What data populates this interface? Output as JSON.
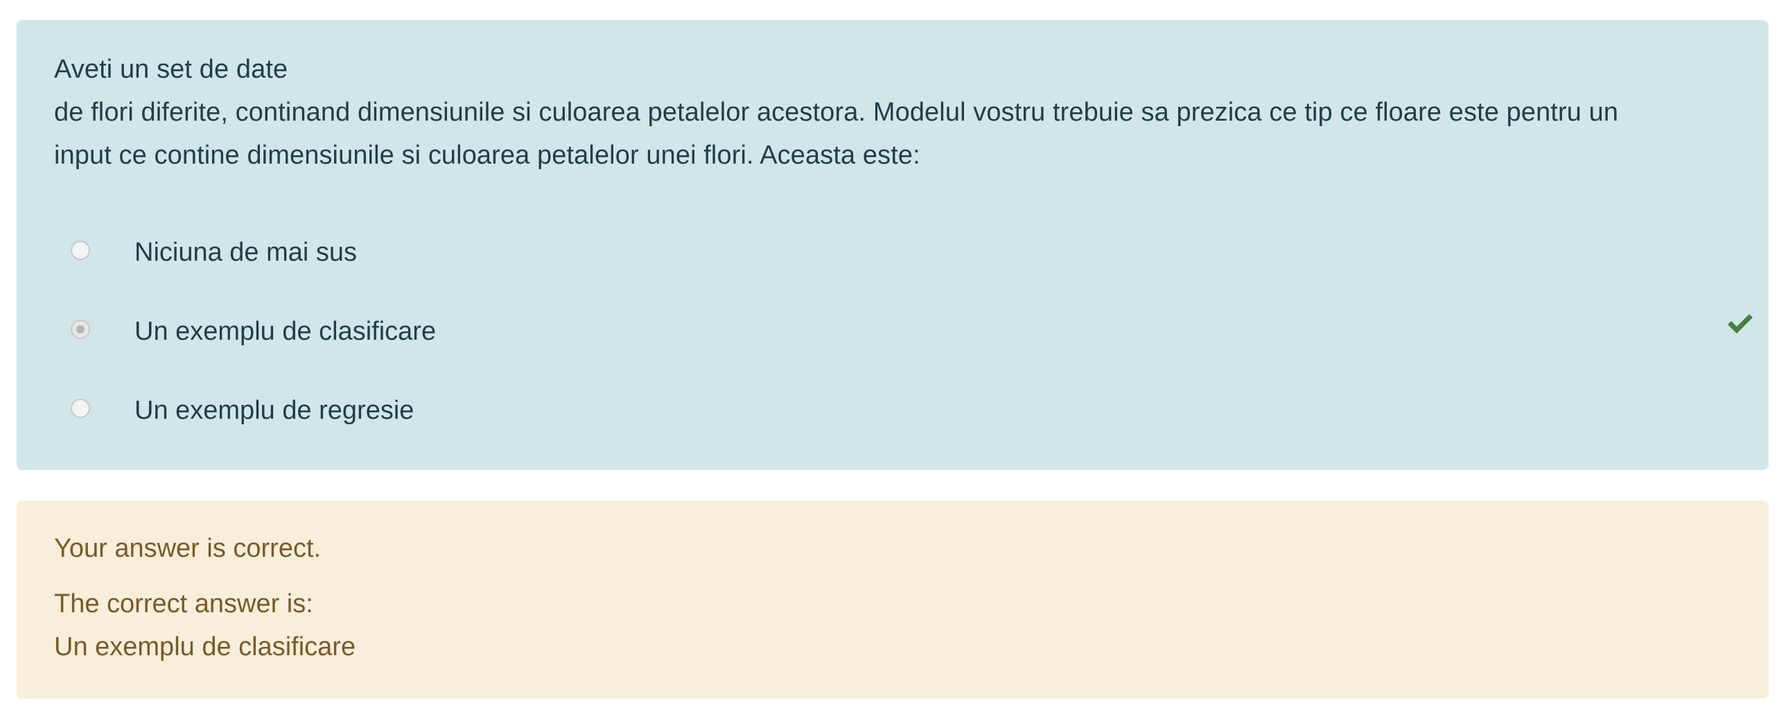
{
  "question": {
    "text_line_1": "Aveti un set de date",
    "text_line_2": "de flori diferite, continand dimensiunile si culoarea petalelor acestora. Modelul vostru trebuie sa prezica ce tip ce floare este pentru un",
    "text_line_3": "input ce contine dimensiunile si culoarea petalelor unei flori. Aceasta este:"
  },
  "answers": [
    {
      "label": "Niciuna de mai sus",
      "selected": false
    },
    {
      "label": "Un exemplu de clasificare",
      "selected": true,
      "correct_icon": "check-icon"
    },
    {
      "label": "Un exemplu de regresie",
      "selected": false
    }
  ],
  "feedback": {
    "result": "Your answer is correct.",
    "correct_answer_label": "The correct answer is:",
    "correct_answer_value": "Un exemplu de clasificare"
  },
  "colors": {
    "question_bg": "#d1e6e9",
    "question_text": "#1f3f47",
    "feedback_bg": "#f8eedb",
    "feedback_text": "#7a5a28",
    "check_green": "#4a7f42"
  }
}
